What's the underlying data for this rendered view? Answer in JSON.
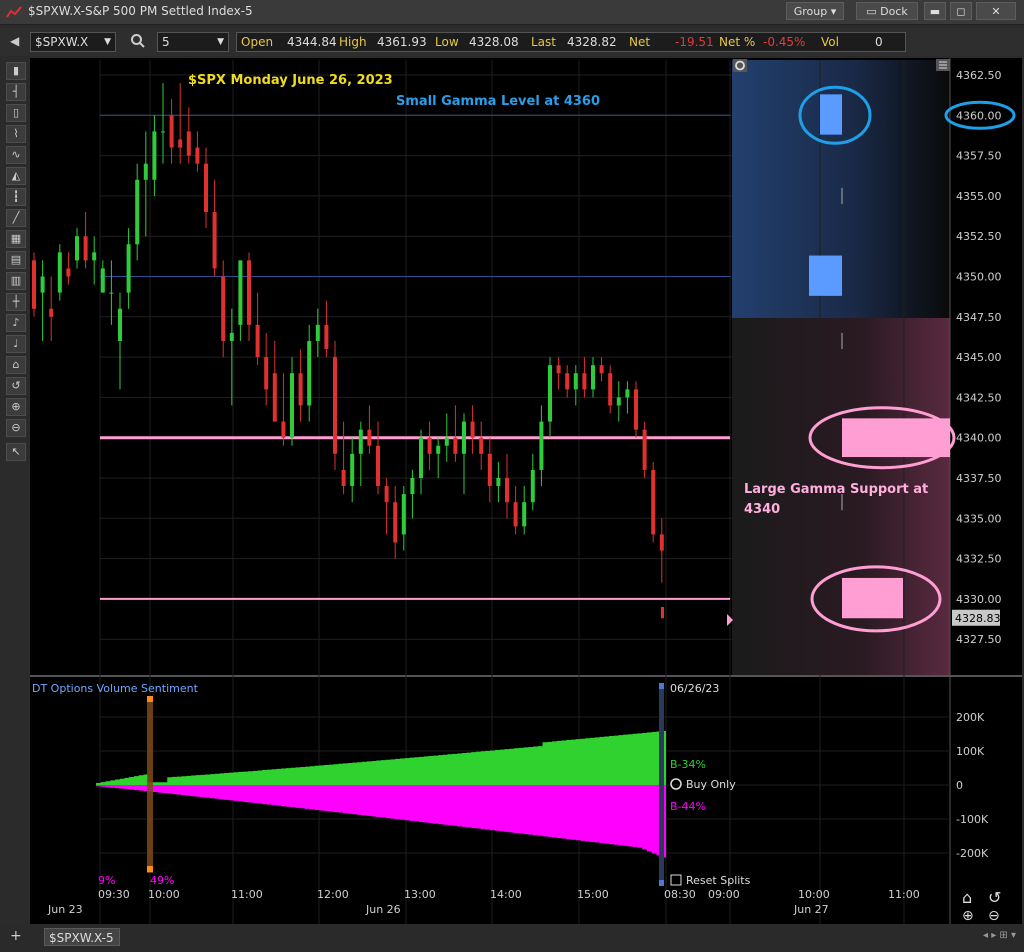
{
  "window": {
    "title": "$SPXW.X-S&P 500 PM Settled Index-5",
    "group_label": "Group",
    "dock_label": "Dock"
  },
  "toolbar": {
    "symbol": "$SPXW.X",
    "interval": "5",
    "quote": {
      "open_label": "Open",
      "open": "4344.84",
      "high_label": "High",
      "high": "4361.93",
      "low_label": "Low",
      "low": "4328.08",
      "last_label": "Last",
      "last": "4328.82",
      "net_label": "Net",
      "net": "-19.51",
      "netpct_label": "Net %",
      "netpct": "-0.45%",
      "vol_label": "Vol",
      "vol": "0"
    }
  },
  "annotations": {
    "chart_title": "$SPX Monday June 26, 2023",
    "small_gamma": "Small Gamma Level at 4360",
    "large_gamma_line1": "Large Gamma Support at",
    "large_gamma_line2": "4340"
  },
  "price_axis": {
    "ticks": [
      "4362.50",
      "4360.00",
      "4357.50",
      "4355.00",
      "4352.50",
      "4350.00",
      "4347.50",
      "4345.00",
      "4342.50",
      "4340.00",
      "4337.50",
      "4335.00",
      "4332.50",
      "4330.00",
      "4327.50"
    ],
    "last_price": "4328.83"
  },
  "indicator": {
    "title": "DT Options Volume Sentiment",
    "date": "06/26/23",
    "buy_pct": "B-34%",
    "sell_pct": "B-44%",
    "buy_only": "Buy Only",
    "reset_splits": "Reset Splits",
    "ticks": [
      "200K",
      "100K",
      "0",
      "-100K",
      "-200K"
    ],
    "left_pct_1": "9%",
    "left_pct_2": "49%"
  },
  "time_axis": {
    "labels": [
      "09:30",
      "10:00",
      "11:00",
      "12:00",
      "13:00",
      "14:00",
      "15:00",
      "08:30",
      "09:00",
      "10:00",
      "11:00"
    ],
    "dates": [
      "Jun 23",
      "Jun 26",
      "Jun 27"
    ]
  },
  "tab": {
    "label": "$SPXW.X-5"
  },
  "colors": {
    "up": "#2ecc3a",
    "down": "#e03030",
    "pink": "#ff9ed2",
    "blue": "#5b9bff",
    "circle_blue": "#1ea0e8",
    "magenta": "#ff00ff",
    "green": "#2fd22f"
  }
}
